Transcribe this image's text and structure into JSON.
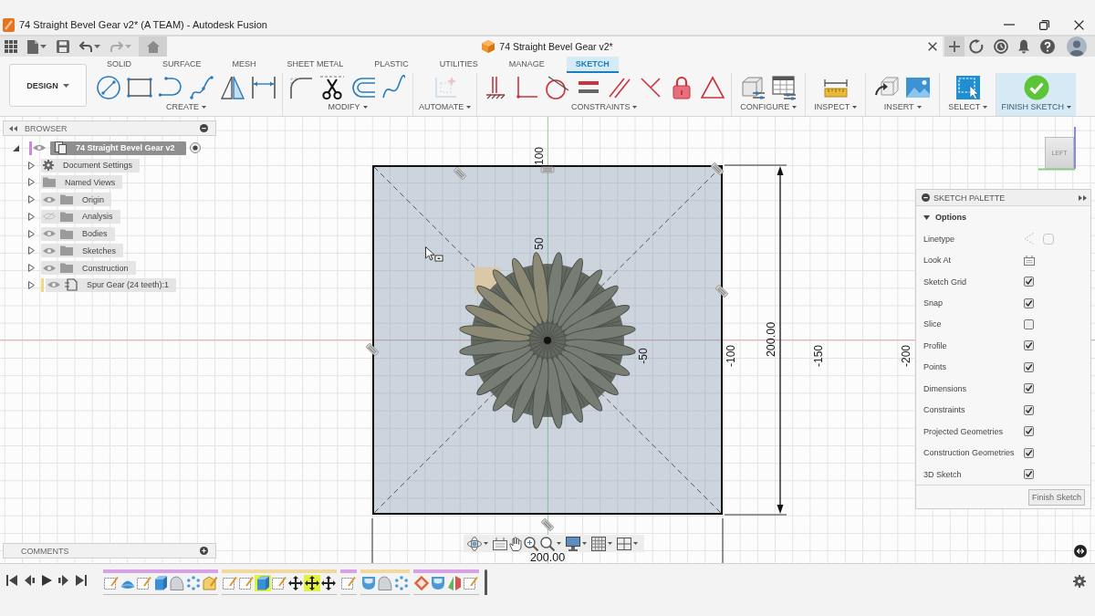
{
  "window": {
    "title": "74 Straight Bevel Gear v2* (A TEAM) - Autodesk Fusion"
  },
  "document_tab": {
    "title": "74 Straight Bevel Gear v2*"
  },
  "workspace_menu": {
    "label": "DESIGN"
  },
  "toolbar_tabs": [
    {
      "label": "SOLID",
      "selected": false
    },
    {
      "label": "SURFACE",
      "selected": false
    },
    {
      "label": "MESH",
      "selected": false
    },
    {
      "label": "SHEET METAL",
      "selected": false
    },
    {
      "label": "PLASTIC",
      "selected": false
    },
    {
      "label": "UTILITIES",
      "selected": false
    },
    {
      "label": "MANAGE",
      "selected": false
    },
    {
      "label": "SKETCH",
      "selected": true
    }
  ],
  "tool_groups": [
    {
      "label": "CREATE",
      "disabled": false
    },
    {
      "label": "MODIFY",
      "disabled": false
    },
    {
      "label": "AUTOMATE",
      "disabled": true
    },
    {
      "label": "CONSTRAINTS",
      "disabled": false
    },
    {
      "label": "CONFIGURE",
      "disabled": false
    },
    {
      "label": "INSPECT",
      "disabled": false
    },
    {
      "label": "INSERT",
      "disabled": false
    },
    {
      "label": "SELECT",
      "disabled": false
    }
  ],
  "finish_sketch": {
    "label": "FINISH SKETCH"
  },
  "browser": {
    "title": "BROWSER",
    "root": {
      "label": "74 Straight Bevel Gear v2",
      "selected": true,
      "expanded": true,
      "visible": true,
      "color": "#c98ad8",
      "children": [
        {
          "label": "Document Settings",
          "kind": "settings",
          "selected": false,
          "expanded": false
        },
        {
          "label": "Named Views",
          "kind": "folder",
          "selected": false,
          "expanded": false
        },
        {
          "label": "Origin",
          "kind": "folder",
          "selected": false,
          "expanded": false,
          "visible": true
        },
        {
          "label": "Analysis",
          "kind": "folder",
          "selected": false,
          "expanded": false,
          "visible": false
        },
        {
          "label": "Bodies",
          "kind": "folder",
          "selected": false,
          "expanded": false,
          "visible": true
        },
        {
          "label": "Sketches",
          "kind": "folder",
          "selected": false,
          "expanded": false,
          "visible": true
        },
        {
          "label": "Construction",
          "kind": "folder",
          "selected": false,
          "expanded": false,
          "visible": true
        },
        {
          "label": "Spur Gear (24 teeth):1",
          "kind": "component",
          "selected": false,
          "expanded": false,
          "visible": true,
          "color": "#f2d680"
        }
      ]
    }
  },
  "comments": {
    "title": "COMMENTS"
  },
  "canvas": {
    "view_cube": {
      "label": "LEFT"
    },
    "vertical_axis_labels": [
      "100",
      "50"
    ],
    "horizontal_axis_labels": [
      "-50",
      "-100",
      "-150",
      "-200"
    ],
    "sketch": {
      "height_dimension": "200.00",
      "width_dimension": "200.00"
    }
  },
  "sketch_palette": {
    "title": "SKETCH PALETTE",
    "section": {
      "label": "Options",
      "expanded": true
    },
    "options": [
      {
        "label": "Linetype",
        "kind": "linetype"
      },
      {
        "label": "Look At",
        "kind": "look_at"
      },
      {
        "label": "Sketch Grid",
        "kind": "checkbox",
        "checked": true
      },
      {
        "label": "Snap",
        "kind": "checkbox",
        "checked": true
      },
      {
        "label": "Slice",
        "kind": "checkbox",
        "checked": false
      },
      {
        "label": "Profile",
        "kind": "checkbox",
        "checked": true
      },
      {
        "label": "Points",
        "kind": "checkbox",
        "checked": true
      },
      {
        "label": "Dimensions",
        "kind": "checkbox",
        "checked": true
      },
      {
        "label": "Constraints",
        "kind": "checkbox",
        "checked": true
      },
      {
        "label": "Projected Geometries",
        "kind": "checkbox",
        "checked": true
      },
      {
        "label": "Construction Geometries",
        "kind": "checkbox",
        "checked": true
      },
      {
        "label": "3D Sketch",
        "kind": "checkbox",
        "checked": true
      }
    ],
    "finish_button": "Finish Sketch"
  },
  "timeline": {
    "groups": [
      {
        "color": "#d7a2e3",
        "items": [
          {
            "kind": "sketch",
            "selected": false
          },
          {
            "kind": "surface",
            "selected": false
          },
          {
            "kind": "sketch",
            "selected": false
          },
          {
            "kind": "box",
            "selected": false
          },
          {
            "kind": "solid",
            "selected": false
          },
          {
            "kind": "pattern",
            "selected": false
          },
          {
            "kind": "face",
            "selected": false
          }
        ]
      },
      {
        "color": "#f0d89e",
        "items": [
          {
            "kind": "sketch",
            "selected": false
          },
          {
            "kind": "sketch",
            "selected": false
          },
          {
            "kind": "box",
            "selected": true
          },
          {
            "kind": "sketch",
            "selected": false
          },
          {
            "kind": "move",
            "selected": false
          },
          {
            "kind": "move",
            "selected": true
          },
          {
            "kind": "move",
            "selected": false
          }
        ]
      },
      {
        "color": "#d7a2e3",
        "items": [
          {
            "kind": "sketch",
            "selected": false
          }
        ]
      },
      {
        "color": "#f0d89e",
        "items": [
          {
            "kind": "cup",
            "selected": false
          },
          {
            "kind": "solid",
            "selected": false
          },
          {
            "kind": "pattern",
            "selected": false
          }
        ]
      },
      {
        "color": "#d7a2e3",
        "items": [
          {
            "kind": "point",
            "selected": false
          },
          {
            "kind": "cup",
            "selected": false
          },
          {
            "kind": "split",
            "selected": false
          },
          {
            "kind": "sketch",
            "selected": false
          }
        ]
      }
    ]
  }
}
